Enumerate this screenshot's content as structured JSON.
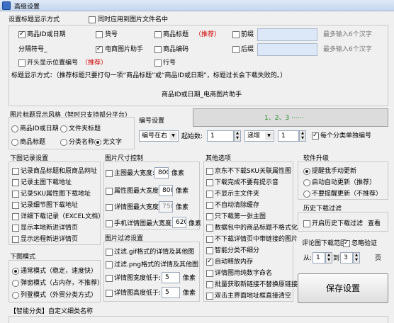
{
  "window": {
    "title": "高级设置"
  },
  "title_display": {
    "header": "设置标题显示方式",
    "sync_filename": "同时应用到图片文件名中",
    "opt_product_id_date": "商品ID或日期",
    "opt_item_no": "货号",
    "opt_product_title": "商品标题",
    "recommend": "（推荐）",
    "opt_prefix": "前缀",
    "max6_a": "最多输入6个汉字",
    "separator": "分隔符号_",
    "opt_ecom_helper": "电商图片助手",
    "opt_product_code": "商品编码",
    "opt_suffix": "后缀",
    "max6_b": "最多输入6个汉字",
    "opt_show_position": "开头显示位置编号",
    "recommend2": "（推荐）",
    "opt_line_no": "行号",
    "hint": "标题显示方式：（推荐标题只要打勾一项“商品标题”或“商品ID或日期”，标题过长会下载失败的。）",
    "preview_text": "商品ID或日期_电商图片助手"
  },
  "image_style": {
    "header": "图片标题显示风格（智时只支持部分平台）",
    "opt_product_id_date": "商品ID或日期",
    "opt_file_title": "文件夹标题",
    "opt_title": "商品标题",
    "opt_category": "分类名称",
    "opt_none": "无文字"
  },
  "numbering": {
    "header": "编号设置",
    "preview": "1、2、3 ······",
    "position_select": "编号在右",
    "start_label": "起始数:",
    "start_value": "1",
    "mode_select": "递增",
    "step_value": "1",
    "per_category": "每个分类单独编号"
  },
  "download_record": {
    "header": "下图记录设置",
    "items": [
      "记录商品标题和原商品网址",
      "记录主图下载地址",
      "记录SKU属性图下载地址",
      "记录细节图下载地址",
      "详细下载记录（EXCEL文档）",
      "显示本地新进详情页",
      "显示远程新进详情页"
    ]
  },
  "download_mode": {
    "header": "下图模式",
    "items": [
      "通常模式（稳定，速度快）",
      "弹窗模式（占内存，不推荐）",
      "列登模式（外贸分类方式）"
    ]
  },
  "size_control": {
    "header": "图片尺寸控制",
    "main_max_width": "主图最大宽度:",
    "main_val": "800",
    "unit": "像素",
    "attr_max_width": "属性图最大宽度:",
    "attr_val": "800",
    "detail_max_width": "详情图最大宽度:",
    "detail_val": "750",
    "mobile_max_width": "手机详情图最大宽度:",
    "mobile_val": "620"
  },
  "filter_settings": {
    "header": "图片过滤设置",
    "filter_gif": "过滤.gif格式的详情及其他图",
    "filter_png": "过滤.png格式的详情及其他图",
    "width_less": "详情图宽度低于:",
    "width_val": "5",
    "height_less": "详情图高度低于:",
    "height_val": "5",
    "unit": "像素"
  },
  "other_options": {
    "header": "其他选项",
    "items": [
      "京东不下载SKU关联属性图",
      "下载完成不要有提示音",
      "不显示主文件夹",
      "不自动清除缓存",
      "只下载第一张主图",
      "数据包中的商品标题不格式化",
      "不下载详情页中带链接的图片",
      "智能分类不细分",
      "自动释放内存",
      "详情图用纯数字命名",
      "批量获取新链接不替换原链接",
      "双击主界面地址框直接清空"
    ]
  },
  "software_upgrade": {
    "header": "软件升级",
    "items": [
      "提醒我手动更新",
      "启动自动更新（推荐）",
      "不要提醒更新（不推荐）"
    ]
  },
  "history_filter": {
    "header": "历史下载过滤",
    "enable": "开启历史下载过滤",
    "view": "查看"
  },
  "review_range": {
    "header": "评论图下载范围",
    "ignore_verify": "忽略验证",
    "from_label": "从:",
    "from_val": "1",
    "to_label": "到",
    "to_val": "3",
    "page": "页"
  },
  "save_button": "保存设置",
  "smart_category": {
    "header": "【智能分类】自定义细类名称"
  }
}
